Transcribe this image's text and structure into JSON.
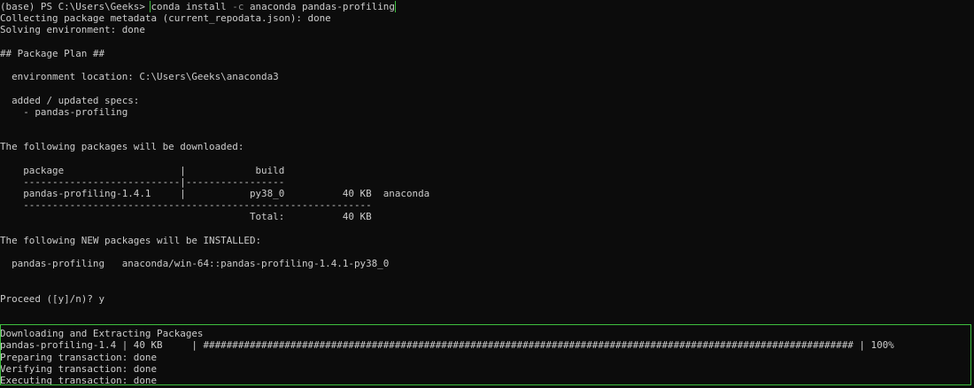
{
  "terminal": {
    "prompt": "(base) PS C:\\Users\\Geeks> ",
    "command": {
      "pre": "conda install ",
      "flag": "-c",
      "post": " anaconda pandas-profiling"
    },
    "lines": [
      "Collecting package metadata (current_repodata.json): done",
      "Solving environment: done",
      "",
      "## Package Plan ##",
      "",
      "  environment location: C:\\Users\\Geeks\\anaconda3",
      "",
      "  added / updated specs:",
      "    - pandas-profiling",
      "",
      "",
      "The following packages will be downloaded:",
      "",
      "    package                    |            build",
      "    ---------------------------|-----------------",
      "    pandas-profiling-1.4.1     |           py38_0          40 KB  anaconda",
      "    ------------------------------------------------------------",
      "                                           Total:          40 KB",
      "",
      "The following NEW packages will be INSTALLED:",
      "",
      "  pandas-profiling   anaconda/win-64::pandas-profiling-1.4.1-py38_0",
      "",
      "",
      "Proceed ([y]/n)? y",
      "",
      "",
      "Downloading and Extracting Packages",
      "pandas-profiling-1.4 | 40 KB     | ################################################################################################################ | 100%",
      "Preparing transaction: done",
      "Verifying transaction: done",
      "Executing transaction: done"
    ]
  }
}
